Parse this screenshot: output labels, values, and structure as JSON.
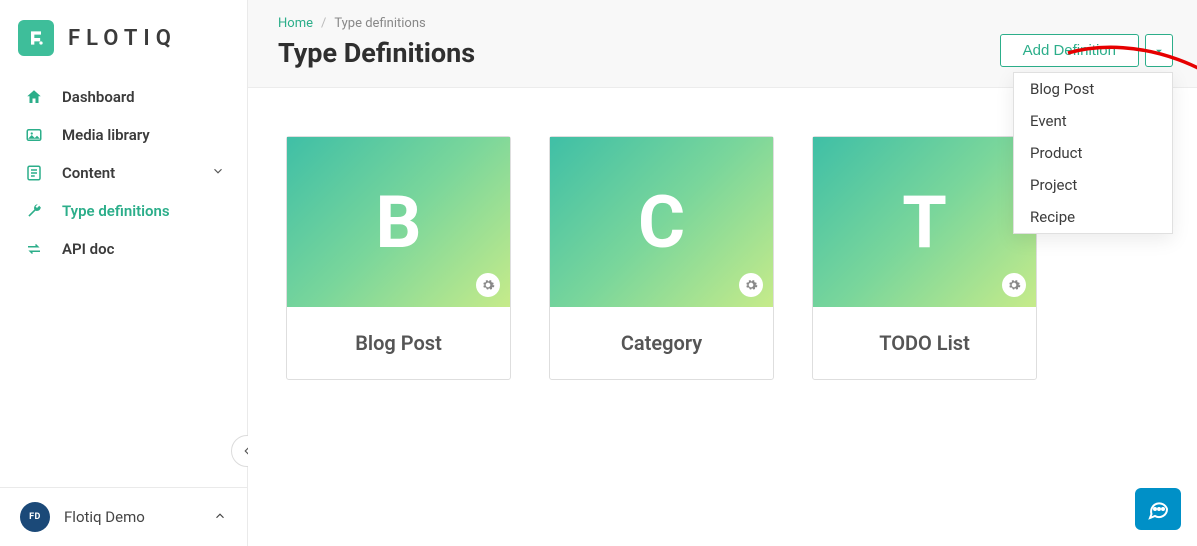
{
  "logo": {
    "text": "FLOTIQ"
  },
  "sidebar": {
    "items": [
      {
        "label": "Dashboard",
        "icon": "home-icon"
      },
      {
        "label": "Media library",
        "icon": "image-icon"
      },
      {
        "label": "Content",
        "icon": "doc-icon",
        "has_chevron": true
      },
      {
        "label": "Type definitions",
        "icon": "wrench-icon",
        "active": true
      },
      {
        "label": "API doc",
        "icon": "swap-icon"
      }
    ]
  },
  "user": {
    "initials": "FD",
    "name": "Flotiq Demo"
  },
  "breadcrumbs": {
    "home": "Home",
    "current": "Type definitions",
    "sep": "/"
  },
  "page": {
    "title": "Type Definitions"
  },
  "actions": {
    "add_definition_label": "Add Definition"
  },
  "dropdown": {
    "items": [
      "Blog Post",
      "Event",
      "Product",
      "Project",
      "Recipe"
    ]
  },
  "cards": [
    {
      "letter": "B",
      "label": "Blog Post"
    },
    {
      "letter": "C",
      "label": "Category"
    },
    {
      "letter": "T",
      "label": "TODO List"
    }
  ]
}
